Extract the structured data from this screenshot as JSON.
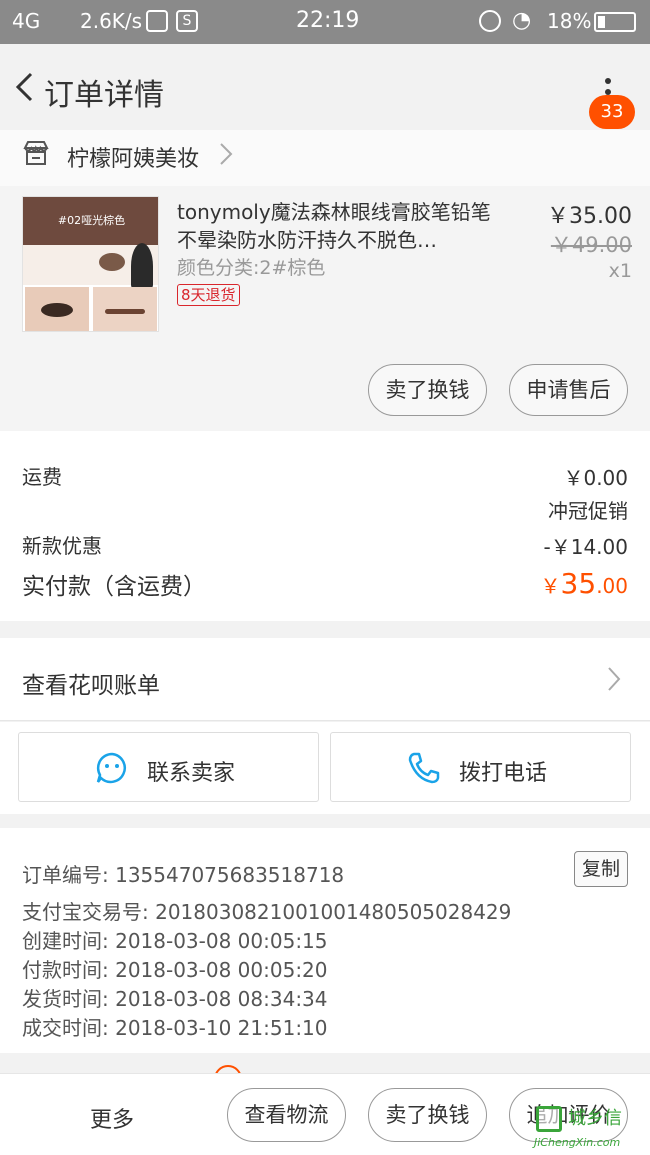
{
  "status_bar": {
    "network": "4G",
    "speed": "2.6K/s",
    "time": "22:19",
    "battery": "18%"
  },
  "nav": {
    "title": "订单详情",
    "badge": "33"
  },
  "shop": {
    "name": "柠檬阿姨美妆"
  },
  "product": {
    "image_label": "#02哑光棕色",
    "title": "tonymoly魔法森林眼线膏胶笔铅笔不晕染防水防汗持久不脱色…",
    "sku": "颜色分类:2#棕色",
    "tag": "8天退货",
    "price": "￥35.00",
    "original_price": "￥49.00",
    "quantity": "x1",
    "buttons": {
      "sell": "卖了换钱",
      "after_sale": "申请售后"
    }
  },
  "costs": {
    "shipping_label": "运费",
    "shipping_value": "￥0.00",
    "promo_note": "冲冠促销",
    "discount_label": "新款优惠",
    "discount_value": "-￥14.00",
    "total_label": "实付款（含运费）",
    "total_currency": "￥",
    "total_int": "35",
    "total_dec": ".00",
    "accent_color": "#ff5000"
  },
  "huabei": {
    "label": "查看花呗账单"
  },
  "contact": {
    "seller": "联系卖家",
    "phone": "拨打电话",
    "icon_color": "#1aa3e8"
  },
  "order_info": {
    "order_no": "订单编号: 1355470756835187​18",
    "alipay_no": "支付宝交易号: 2018030821001001480505028429",
    "created": "创建时间: 2018-03-08 00:05:15",
    "paid": "付款时间: 2018-03-08 00:05:20",
    "shipped": "发货时间: 2018-03-08 08:34:34",
    "closed": "成交时间: 2018-03-10 21:51:10",
    "copy": "复制"
  },
  "bottom_bar": {
    "more": "更多",
    "logistics": "查看物流",
    "sell": "卖了换钱",
    "review": "追加评价"
  },
  "watermark": {
    "text": "城乡信",
    "sub": "JiChengXin.com"
  }
}
